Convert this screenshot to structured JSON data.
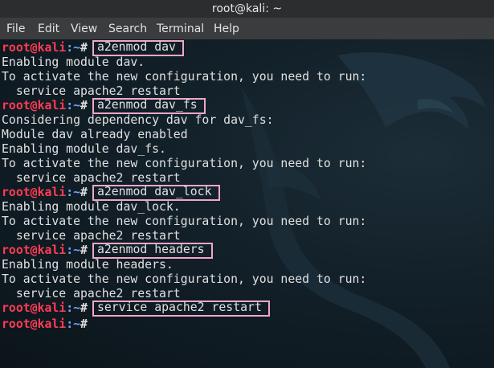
{
  "window": {
    "title": "root@kali: ~"
  },
  "menu": [
    "File",
    "Edit",
    "View",
    "Search",
    "Terminal",
    "Help"
  ],
  "prompt": {
    "user": "root",
    "at": "@",
    "host": "kali",
    "path": ":~",
    "hash": "#"
  },
  "lines": [
    {
      "type": "prompt",
      "cmd": "a2enmod dav"
    },
    {
      "type": "out",
      "text": "Enabling module dav."
    },
    {
      "type": "out",
      "text": "To activate the new configuration, you need to run:"
    },
    {
      "type": "out",
      "text": "  service apache2 restart"
    },
    {
      "type": "prompt",
      "cmd": "a2enmod dav_fs"
    },
    {
      "type": "out",
      "text": "Considering dependency dav for dav_fs:"
    },
    {
      "type": "out",
      "text": "Module dav already enabled"
    },
    {
      "type": "out",
      "text": "Enabling module dav_fs."
    },
    {
      "type": "out",
      "text": "To activate the new configuration, you need to run:"
    },
    {
      "type": "out",
      "text": "  service apache2 restart"
    },
    {
      "type": "prompt",
      "cmd": "a2enmod dav_lock"
    },
    {
      "type": "out",
      "text": "Enabling module dav_lock."
    },
    {
      "type": "out",
      "text": "To activate the new configuration, you need to run:"
    },
    {
      "type": "out",
      "text": "  service apache2 restart"
    },
    {
      "type": "prompt",
      "cmd": "a2enmod headers"
    },
    {
      "type": "out",
      "text": "Enabling module headers."
    },
    {
      "type": "out",
      "text": "To activate the new configuration, you need to run:"
    },
    {
      "type": "out",
      "text": "  service apache2 restart"
    },
    {
      "type": "prompt",
      "cmd": "service apache2 restart"
    },
    {
      "type": "prompt",
      "cmd": ""
    }
  ],
  "colors": {
    "prompt_user": "#ff3c55",
    "prompt_path": "#6ea6ff",
    "highlight_box": "#f0a7c8"
  }
}
